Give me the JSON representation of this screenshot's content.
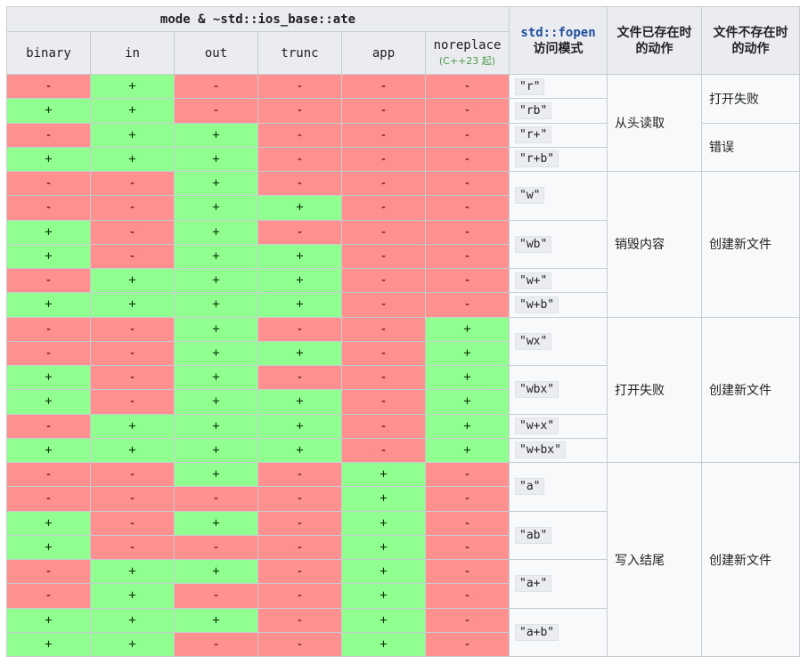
{
  "header": {
    "top_label": "mode & ~std::ios_base::ate",
    "columns": [
      "binary",
      "in",
      "out",
      "trunc",
      "app",
      "noreplace"
    ],
    "noreplace_note": "(C++23 起)",
    "fopen_code": "std::fopen",
    "fopen_label": "访问模式",
    "exists_label_1": "文件已存在时",
    "exists_label_2": "的动作",
    "notexists_label_1": "文件不存在时",
    "notexists_label_2": "的动作"
  },
  "colors": {
    "yes": "#90ff90",
    "no": "#ff9090",
    "header": "#eaecf0"
  },
  "rows": [
    [
      "-",
      "+",
      "-",
      "-",
      "-",
      "-"
    ],
    [
      "+",
      "+",
      "-",
      "-",
      "-",
      "-"
    ],
    [
      "-",
      "+",
      "+",
      "-",
      "-",
      "-"
    ],
    [
      "+",
      "+",
      "+",
      "-",
      "-",
      "-"
    ],
    [
      "-",
      "-",
      "+",
      "-",
      "-",
      "-"
    ],
    [
      "-",
      "-",
      "+",
      "+",
      "-",
      "-"
    ],
    [
      "+",
      "-",
      "+",
      "-",
      "-",
      "-"
    ],
    [
      "+",
      "-",
      "+",
      "+",
      "-",
      "-"
    ],
    [
      "-",
      "+",
      "+",
      "+",
      "-",
      "-"
    ],
    [
      "+",
      "+",
      "+",
      "+",
      "-",
      "-"
    ],
    [
      "-",
      "-",
      "+",
      "-",
      "-",
      "+"
    ],
    [
      "-",
      "-",
      "+",
      "+",
      "-",
      "+"
    ],
    [
      "+",
      "-",
      "+",
      "-",
      "-",
      "+"
    ],
    [
      "+",
      "-",
      "+",
      "+",
      "-",
      "+"
    ],
    [
      "-",
      "+",
      "+",
      "+",
      "-",
      "+"
    ],
    [
      "+",
      "+",
      "+",
      "+",
      "-",
      "+"
    ],
    [
      "-",
      "-",
      "+",
      "-",
      "+",
      "-"
    ],
    [
      "-",
      "-",
      "-",
      "-",
      "+",
      "-"
    ],
    [
      "+",
      "-",
      "+",
      "-",
      "+",
      "-"
    ],
    [
      "+",
      "-",
      "-",
      "-",
      "+",
      "-"
    ],
    [
      "-",
      "+",
      "+",
      "-",
      "+",
      "-"
    ],
    [
      "-",
      "+",
      "-",
      "-",
      "+",
      "-"
    ],
    [
      "+",
      "+",
      "+",
      "-",
      "+",
      "-"
    ],
    [
      "+",
      "+",
      "-",
      "-",
      "+",
      "-"
    ]
  ],
  "modes": [
    {
      "text": "\"r\"",
      "start": 1,
      "span": 1
    },
    {
      "text": "\"rb\"",
      "start": 2,
      "span": 1
    },
    {
      "text": "\"r+\"",
      "start": 3,
      "span": 1
    },
    {
      "text": "\"r+b\"",
      "start": 4,
      "span": 1
    },
    {
      "text": "\"w\"",
      "start": 5,
      "span": 2
    },
    {
      "text": "\"wb\"",
      "start": 7,
      "span": 2
    },
    {
      "text": "\"w+\"",
      "start": 9,
      "span": 1
    },
    {
      "text": "\"w+b\"",
      "start": 10,
      "span": 1
    },
    {
      "text": "\"wx\"",
      "start": 11,
      "span": 2
    },
    {
      "text": "\"wbx\"",
      "start": 13,
      "span": 2
    },
    {
      "text": "\"w+x\"",
      "start": 15,
      "span": 1
    },
    {
      "text": "\"w+bx\"",
      "start": 16,
      "span": 1
    },
    {
      "text": "\"a\"",
      "start": 17,
      "span": 2
    },
    {
      "text": "\"ab\"",
      "start": 19,
      "span": 2
    },
    {
      "text": "\"a+\"",
      "start": 21,
      "span": 2
    },
    {
      "text": "\"a+b\"",
      "start": 23,
      "span": 2
    }
  ],
  "exists_actions": [
    {
      "text": "从头读取",
      "start": 1,
      "span": 4
    },
    {
      "text": "销毁内容",
      "start": 5,
      "span": 6
    },
    {
      "text": "打开失败",
      "start": 11,
      "span": 6
    },
    {
      "text": "写入结尾",
      "start": 17,
      "span": 8
    }
  ],
  "notexists_actions": [
    {
      "text": "打开失败",
      "start": 1,
      "span": 2
    },
    {
      "text": "错误",
      "start": 3,
      "span": 2
    },
    {
      "text": "创建新文件",
      "start": 5,
      "span": 6
    },
    {
      "text": "创建新文件",
      "start": 11,
      "span": 6
    },
    {
      "text": "创建新文件",
      "start": 17,
      "span": 8
    }
  ]
}
